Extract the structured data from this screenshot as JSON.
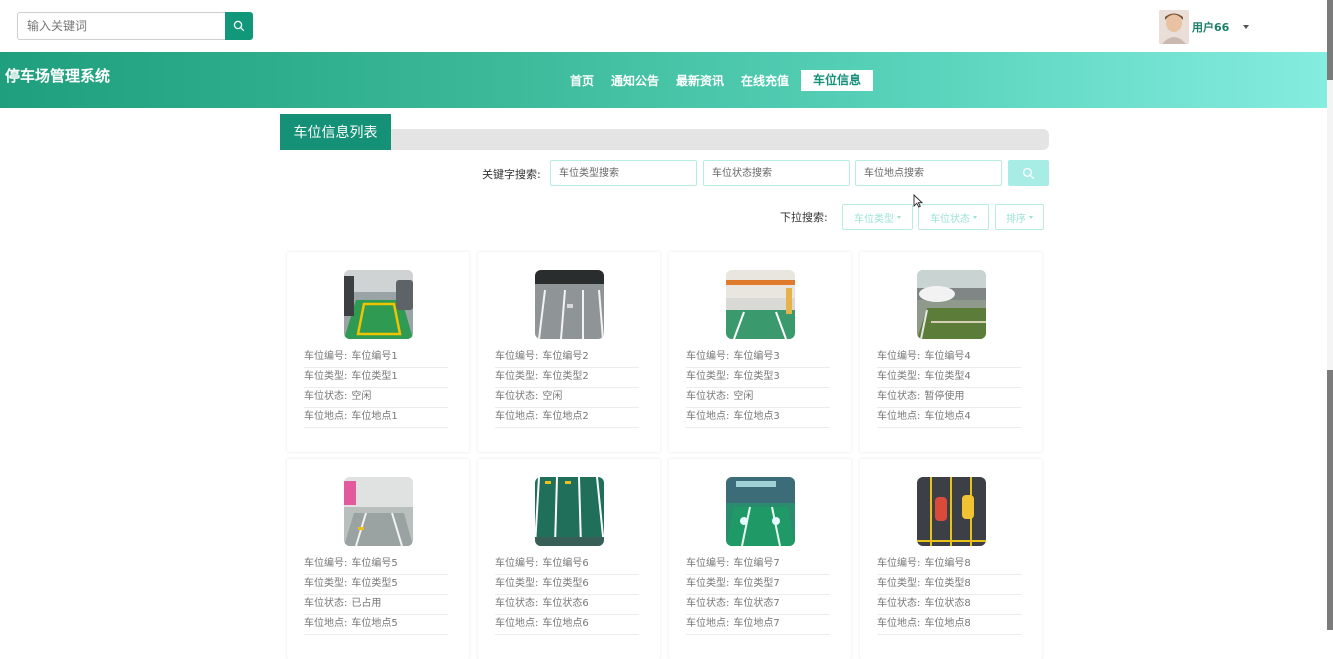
{
  "search": {
    "placeholder": "输入关键词"
  },
  "user": {
    "name": "用户66"
  },
  "site": {
    "title": "停车场管理系统"
  },
  "nav": {
    "items": [
      {
        "label": "首页"
      },
      {
        "label": "通知公告"
      },
      {
        "label": "最新资讯"
      },
      {
        "label": "在线充值"
      },
      {
        "label": "车位信息"
      }
    ],
    "active_index": 4
  },
  "section": {
    "title": "车位信息列表"
  },
  "filters": {
    "keyword_label": "关键字搜索:",
    "type_placeholder": "车位类型搜索",
    "status_placeholder": "车位状态搜索",
    "location_placeholder": "车位地点搜索",
    "dropdown_label": "下拉搜索:",
    "dropdowns": [
      "车位类型",
      "车位状态",
      "排序"
    ]
  },
  "field_labels": {
    "number": "车位编号:",
    "type": "车位类型:",
    "status": "车位状态:",
    "location": "车位地点:"
  },
  "spots": [
    {
      "number": "车位编号1",
      "type": "车位类型1",
      "status": "空闲",
      "location": "车位地点1"
    },
    {
      "number": "车位编号2",
      "type": "车位类型2",
      "status": "空闲",
      "location": "车位地点2"
    },
    {
      "number": "车位编号3",
      "type": "车位类型3",
      "status": "空闲",
      "location": "车位地点3"
    },
    {
      "number": "车位编号4",
      "type": "车位类型4",
      "status": "暂停使用",
      "location": "车位地点4"
    },
    {
      "number": "车位编号5",
      "type": "车位类型5",
      "status": "已占用",
      "location": "车位地点5"
    },
    {
      "number": "车位编号6",
      "type": "车位类型6",
      "status": "车位状态6",
      "location": "车位地点6"
    },
    {
      "number": "车位编号7",
      "type": "车位类型7",
      "status": "车位状态7",
      "location": "车位地点7"
    },
    {
      "number": "车位编号8",
      "type": "车位类型8",
      "status": "车位状态8",
      "location": "车位地点8"
    }
  ],
  "colors": {
    "primary": "#159178",
    "header_start": "#1f9f7d",
    "header_end": "#85ece0",
    "accent_light": "#a7ece5"
  }
}
